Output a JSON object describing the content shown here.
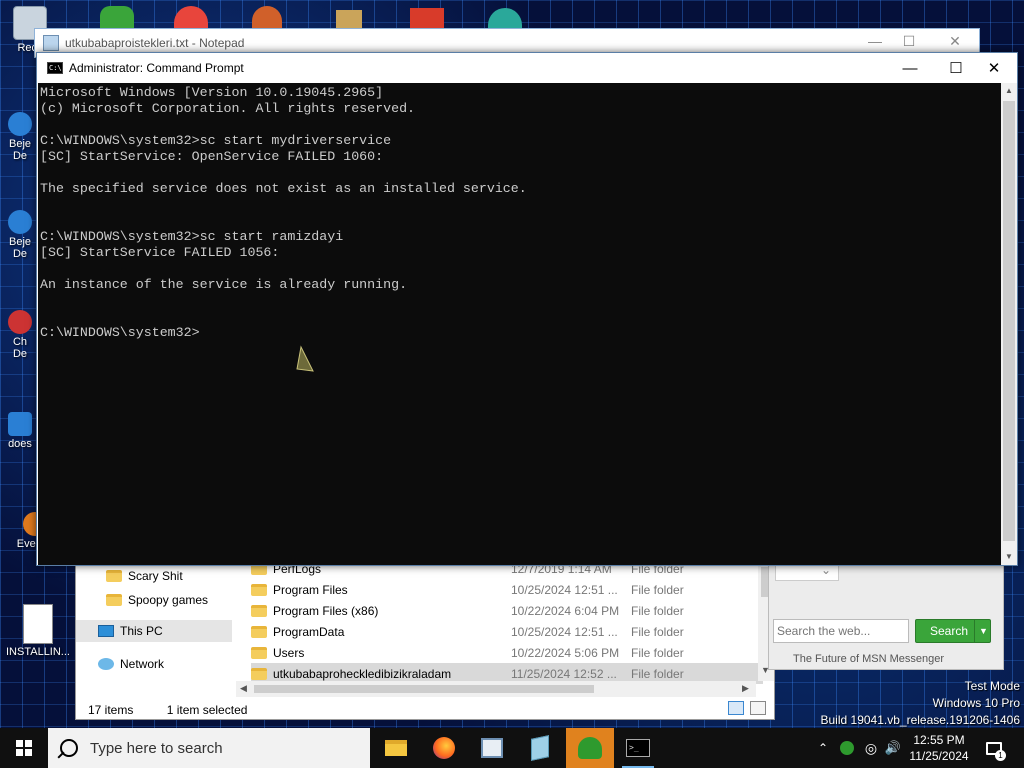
{
  "notepad": {
    "title": "utkubabaproistekleri.txt - Notepad"
  },
  "cmd": {
    "title": "Administrator: Command Prompt",
    "lines": [
      "Microsoft Windows [Version 10.0.19045.2965]",
      "(c) Microsoft Corporation. All rights reserved.",
      "",
      "C:\\WINDOWS\\system32>sc start mydriverservice",
      "[SC] StartService: OpenService FAILED 1060:",
      "",
      "The specified service does not exist as an installed service.",
      "",
      "",
      "C:\\WINDOWS\\system32>sc start ramizdayi",
      "[SC] StartService FAILED 1056:",
      "",
      "An instance of the service is already running.",
      "",
      "",
      "C:\\WINDOWS\\system32>"
    ]
  },
  "desktop": {
    "icons": [
      {
        "label": "Recy"
      },
      {
        "label": "Beje\nDe"
      },
      {
        "label": "Beje\nDe"
      },
      {
        "label": "Ch\nDe"
      },
      {
        "label": "does"
      },
      {
        "label": "Every..."
      },
      {
        "label": "INSTALLIN..."
      }
    ]
  },
  "explorer": {
    "nav": [
      {
        "label": "Scary Shit",
        "icon": "folder-icon"
      },
      {
        "label": "Spoopy games",
        "icon": "folder-icon"
      },
      {
        "label": "This PC",
        "icon": "computer-icon"
      },
      {
        "label": "Network",
        "icon": "network-icon"
      }
    ],
    "files": [
      {
        "name": "PerfLogs",
        "date": "12/7/2019 1:14 AM",
        "type": "File folder"
      },
      {
        "name": "Program Files",
        "date": "10/25/2024 12:51 ...",
        "type": "File folder"
      },
      {
        "name": "Program Files (x86)",
        "date": "10/22/2024 6:04 PM",
        "type": "File folder"
      },
      {
        "name": "ProgramData",
        "date": "10/25/2024 12:51 ...",
        "type": "File folder"
      },
      {
        "name": "Users",
        "date": "10/22/2024 5:06 PM",
        "type": "File folder"
      },
      {
        "name": "utkubabaproheckledibizikraladam",
        "date": "11/25/2024 12:52 ...",
        "type": "File folder"
      }
    ],
    "status_items": "17 items",
    "status_selected": "1 item selected"
  },
  "msn": {
    "search_placeholder": "Search the web...",
    "search_button": "Search",
    "footer": "The Future of MSN Messenger"
  },
  "watermark": {
    "line1": "Test Mode",
    "line2": "Windows 10 Pro",
    "line3": "Build 19041.vb_release.191206-1406"
  },
  "taskbar": {
    "search_placeholder": "Type here to search",
    "time": "12:55 PM",
    "date": "11/25/2024",
    "apps": [
      "file-explorer-icon",
      "firefox-icon",
      "notepad-icon",
      "document-icon",
      "msn-messenger-icon",
      "command-prompt-icon"
    ]
  },
  "colors": {
    "console_bg": "#0c0c0c",
    "console_text": "#cccccc",
    "taskbar_bg": "#101010",
    "active_app": "#e0821e",
    "msn_green": "#3aa53a"
  }
}
